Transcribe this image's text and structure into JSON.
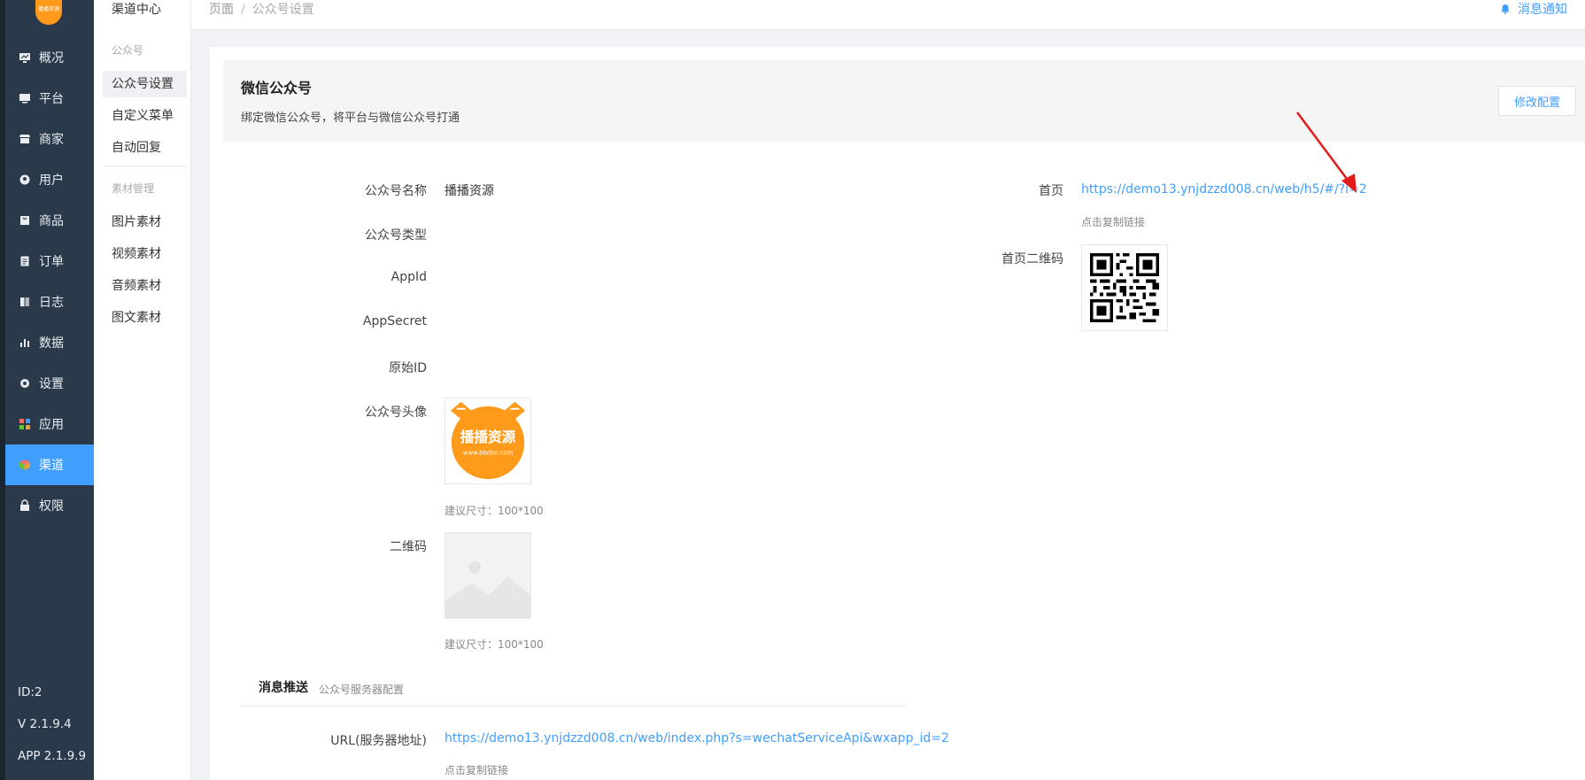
{
  "sidebar": {
    "logo_text": "播播资源",
    "items": [
      {
        "label": "概况",
        "icon": "monitor-icon"
      },
      {
        "label": "平台",
        "icon": "desktop-icon"
      },
      {
        "label": "商家",
        "icon": "store-icon"
      },
      {
        "label": "用户",
        "icon": "user-icon"
      },
      {
        "label": "商品",
        "icon": "bag-icon"
      },
      {
        "label": "订单",
        "icon": "clipboard-icon"
      },
      {
        "label": "日志",
        "icon": "book-icon"
      },
      {
        "label": "数据",
        "icon": "bar-chart-icon"
      },
      {
        "label": "设置",
        "icon": "gear-icon"
      },
      {
        "label": "应用",
        "icon": "apps-grid-icon"
      },
      {
        "label": "渠道",
        "icon": "cube-icon",
        "active": true
      },
      {
        "label": "权限",
        "icon": "lock-icon"
      }
    ],
    "footer": {
      "id": "ID:2",
      "version": "V 2.1.9.4",
      "app_version": "APP 2.1.9.9"
    },
    "accent_color": "#409eff",
    "background_color": "#2b3a4a"
  },
  "submenu": {
    "title": "渠道中心",
    "group1": "公众号",
    "items1": [
      "公众号设置",
      "自定义菜单",
      "自动回复"
    ],
    "group2": "素材管理",
    "items2": [
      "图片素材",
      "视频素材",
      "音频素材",
      "图文素材"
    ]
  },
  "topbar": {
    "breadcrumb_root": "页面",
    "breadcrumb_sep": "/",
    "breadcrumb_current": "公众号设置",
    "notify": "消息通知"
  },
  "header": {
    "title": "微信公众号",
    "desc": "绑定微信公众号，将平台与微信公众号打通",
    "edit_button": "修改配置"
  },
  "form": {
    "name_label": "公众号名称",
    "name_value": "播播资源",
    "type_label": "公众号类型",
    "appid_label": "AppId",
    "appsecret_label": "AppSecret",
    "originid_label": "原始ID",
    "avatar_label": "公众号头像",
    "avatar_text": "播播资源",
    "avatar_url": "www.bbobo.com",
    "avatar_hint": "建议尺寸：100*100",
    "qrcode_label": "二维码",
    "qrcode_hint": "建议尺寸：100*100"
  },
  "right": {
    "home_label": "首页",
    "home_url": "https://demo13.ynjdzzd008.cn/web/h5/#/?i=2",
    "copy_hint": "点击复制链接",
    "home_qr_label": "首页二维码"
  },
  "push": {
    "title": "消息推送",
    "subtitle": "公众号服务器配置",
    "url_label": "URL(服务器地址)",
    "url_value": "https://demo13.ynjdzzd008.cn/web/index.php?s=wechatServiceApi&wxapp_id=2",
    "copy_hint": "点击复制链接"
  }
}
